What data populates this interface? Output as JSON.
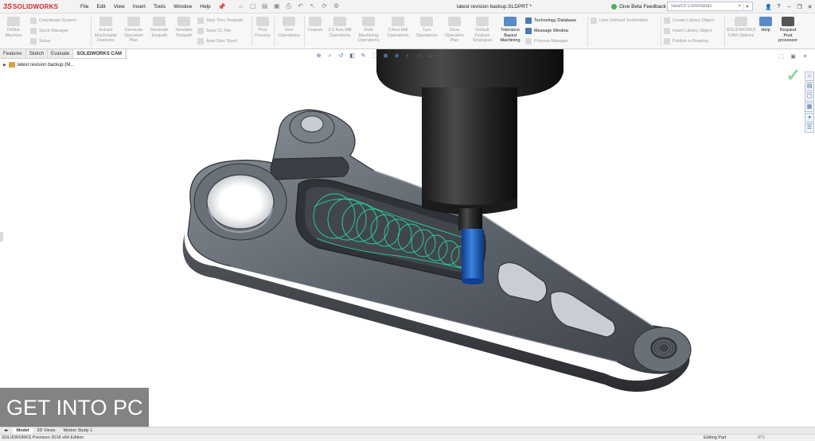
{
  "app": {
    "logo_mark": "3S",
    "logo_text": "SOLIDWORKS"
  },
  "menu": [
    "File",
    "Edit",
    "View",
    "Insert",
    "Tools",
    "Window",
    "Help"
  ],
  "quick_icons": [
    "home-icon",
    "new-doc-icon",
    "open-icon",
    "save-icon",
    "print-icon",
    "undo-icon",
    "select-icon",
    "rebuild-icon",
    "options-icon"
  ],
  "document_title": "latest revision backup.SLDPRT *",
  "feedback": {
    "label": "Give Beta Feedback"
  },
  "search": {
    "placeholder": "Search Commands"
  },
  "window_controls": [
    "?",
    "–",
    "❐",
    "✕"
  ],
  "ribbon": {
    "define_machine": "Define Machine",
    "coordinate_system": "Coordinate System",
    "stock_manager": "Stock Manager",
    "setup": "Setup",
    "extract": "Extract Machinable Features",
    "generate_op": "Generate Operation Plan",
    "generate_tp": "Generate Toolpath",
    "simulate_tp": "Simulate Toolpath",
    "step_thru": "Step Thru Toolpath",
    "save_cl": "Save CL File",
    "auto_size": "Auto-Size Stock",
    "post_process": "Post Process",
    "sort_ops": "Sort Operations",
    "feature": "Feature",
    "mill25": "2.5 Axis Mill Operations",
    "hole": "Hole Machining Operations",
    "mill3": "3 Axis Mill Operations",
    "turn": "Turn Operations",
    "save_op": "Save Operation Plan",
    "default_feat": "Default Feature Strategies",
    "tbm": "Tolerance Based Machining",
    "tech_db": "Technology Database",
    "message_window": "Message Window",
    "process_manager": "Process Manager",
    "user_tool": "User Defined Tool/Holder",
    "create_lib": "Create Library Object",
    "insert_lib": "Insert Library Object",
    "publish": "Publish e-Drawing",
    "cam_options": "SOLIDWORKS CAM Options",
    "help": "Help",
    "request_post": "Request Post processor"
  },
  "tabs": [
    "Features",
    "Sketch",
    "Evaluate",
    "SOLIDWORKS CAM"
  ],
  "tree": {
    "label": "latest revision backup (M..."
  },
  "bottom_tabs": [
    "Model",
    "3D Views",
    "Motion Study 1"
  ],
  "status": {
    "left": "SOLIDWORKS Premium 2018 x64 Edition",
    "mode": "Editing Part",
    "units": "IPS"
  },
  "watermark": {
    "text": "GET INTO PC"
  },
  "colors": {
    "accent": "#4a7ab8",
    "logo": "#d62728",
    "part": "#5c6269",
    "toolpath": "#26b58a",
    "tool_bit": "#1e5fbf"
  }
}
